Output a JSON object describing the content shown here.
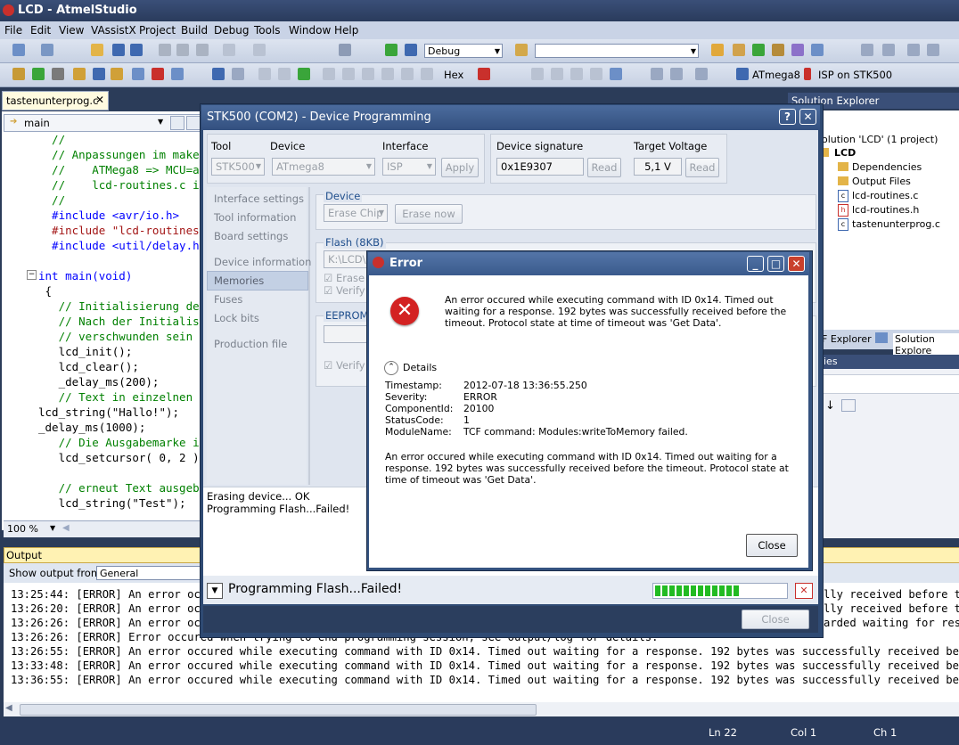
{
  "app": {
    "title": "LCD - AtmelStudio"
  },
  "menu": [
    "File",
    "Edit",
    "View",
    "VAssistX",
    "Project",
    "Build",
    "Debug",
    "Tools",
    "Window",
    "Help"
  ],
  "toolbar": {
    "config": "Debug",
    "search": "",
    "hex_label": "Hex",
    "device_label": "ATmega8",
    "tool_label": "ISP on STK500"
  },
  "editor": {
    "tab": "tastenunterprog.c",
    "nav_function": "main",
    "zoom": "100 %",
    "lines": [
      {
        "text": "  //",
        "cls": "c-comment"
      },
      {
        "text": "  // Anpassungen im makef",
        "cls": "c-comment"
      },
      {
        "text": "  //    ATMega8 => MCU=at",
        "cls": "c-comment"
      },
      {
        "text": "  //    lcd-routines.c in",
        "cls": "c-comment"
      },
      {
        "text": "  //",
        "cls": "c-comment"
      },
      {
        "text": "  #include <avr/io.h>",
        "cls": "c-kw"
      },
      {
        "text": "  #include \"lcd-routines.",
        "cls": "c-str"
      },
      {
        "text": "  #include <util/delay.h>",
        "cls": "c-kw"
      },
      {
        "text": "",
        "cls": ""
      },
      {
        "text": "int main(void)",
        "cls": "c-kw"
      },
      {
        "text": " {",
        "cls": ""
      },
      {
        "text": "   // Initialisierung de",
        "cls": "c-comment"
      },
      {
        "text": "   // Nach der Initialis",
        "cls": "c-comment"
      },
      {
        "text": "   // verschwunden sein",
        "cls": "c-comment"
      },
      {
        "text": "   lcd_init();",
        "cls": ""
      },
      {
        "text": "   lcd_clear();",
        "cls": ""
      },
      {
        "text": "   _delay_ms(200);",
        "cls": ""
      },
      {
        "text": "   // Text in einzelnen",
        "cls": "c-comment"
      },
      {
        "text": "lcd_string(\"Hallo!\");",
        "cls": ""
      },
      {
        "text": "_delay_ms(1000);",
        "cls": ""
      },
      {
        "text": "   // Die Ausgabemarke i",
        "cls": "c-comment"
      },
      {
        "text": "   lcd_setcursor( 0, 2 )",
        "cls": ""
      },
      {
        "text": "",
        "cls": ""
      },
      {
        "text": "   // erneut Text ausgeb",
        "cls": "c-comment"
      },
      {
        "text": "   lcd_string(\"Test\");",
        "cls": ""
      }
    ]
  },
  "solution": {
    "header": "Solution Explorer",
    "root": "olution 'LCD' (1 project)",
    "project": "LCD",
    "items": [
      "Dependencies",
      "Output Files",
      "lcd-routines.c",
      "lcd-routines.h",
      "tastenunterprog.c"
    ],
    "tab_left": "F Explorer",
    "tab_right": "Solution Explore",
    "props_header": "ies"
  },
  "output": {
    "header": "Output",
    "show_from_label": "Show output from:",
    "show_from_value": "General",
    "lines": [
      "13:25:44: [ERROR] An error occu",
      "13:26:20: [ERROR] An error occ",
      "13:26:26: [ERROR] An error occ",
      "13:26:26: [ERROR] Error occured when trying to end programming session, see output/log for details.",
      "13:26:55: [ERROR] An error occured while executing command with ID 0x14. Timed out waiting for a response. 192 bytes was successfully received before th",
      "13:33:48: [ERROR] An error occured while executing command with ID 0x14. Timed out waiting for a response. 192 bytes was successfully received before th",
      "13:36:55: [ERROR] An error occured while executing command with ID 0x14. Timed out waiting for a response. 192 bytes was successfully received before th"
    ],
    "right_tails": [
      "lly received before th",
      "lly received before th",
      "arded waiting for respo"
    ]
  },
  "status": {
    "ln": "Ln 22",
    "col": "Col 1",
    "ch": "Ch 1"
  },
  "device_dialog": {
    "title": "STK500 (COM2) - Device Programming",
    "tool_label": "Tool",
    "device_label": "Device",
    "interface_label": "Interface",
    "tool_value": "STK500",
    "device_value": "ATmega8",
    "interface_value": "ISP",
    "apply": "Apply",
    "signature_label": "Device signature",
    "signature_value": "0x1E9307",
    "read": "Read",
    "voltage_label": "Target Voltage",
    "voltage_value": "5,1 V",
    "nav": [
      "Interface settings",
      "Tool information",
      "Board settings",
      "Device information",
      "Memories",
      "Fuses",
      "Lock bits",
      "Production file"
    ],
    "device_group": "Device",
    "erase_chip": "Erase Chip",
    "erase_now": "Erase now",
    "flash_group": "Flash (8KB)",
    "flash_path": "K:\\LCD\\",
    "erase_check": "Erase d",
    "verify_check": "Verify",
    "eeprom_group": "EEPROM (",
    "eeprom_verify": "Verify",
    "log": [
      "Erasing device... OK",
      "Programming Flash...Failed!"
    ],
    "footer_status": "Programming Flash...Failed!",
    "progress": 0.65,
    "close": "Close"
  },
  "error_dialog": {
    "title": "Error",
    "message": "An error occured while executing command with ID 0x14. Timed out waiting for a response. 192 bytes was successfully received before the timeout. Protocol state at time of timeout was 'Get Data'.",
    "details_label": "Details",
    "details": [
      {
        "key": "Timestamp:",
        "value": "2012-07-18 13:36:55.250"
      },
      {
        "key": "Severity:",
        "value": "ERROR"
      },
      {
        "key": "ComponentId:",
        "value": "20100"
      },
      {
        "key": "StatusCode:",
        "value": "1"
      },
      {
        "key": "ModuleName:",
        "value": "TCF command: Modules:writeToMemory failed."
      }
    ],
    "details_message": "An error occured while executing command with ID 0x14. Timed out waiting for a response. 192 bytes was successfully received before the timeout. Protocol state at time of timeout was 'Get Data'.",
    "close": "Close"
  },
  "colors": {
    "accent": "#2f4a73",
    "error": "#d32222",
    "progress": "#22bb22"
  }
}
